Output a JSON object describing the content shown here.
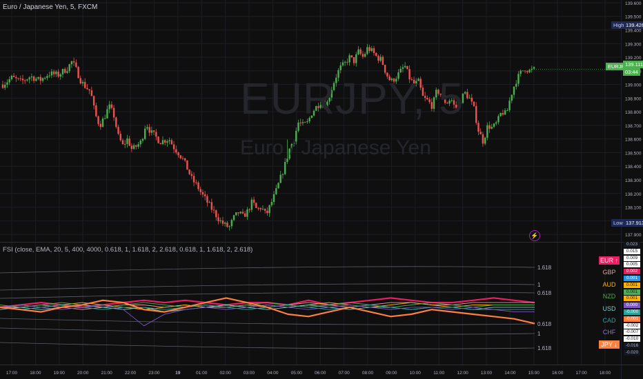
{
  "header": {
    "symbol_title": "Euro / Japanese Yen, 5, FXCM",
    "watermark_symbol": "EURJPY, 5",
    "watermark_name": "Euro / Japanese Yen",
    "indicator_title": "FSI (close, EMA, 20, 5, 400, 4000, 0.618, 1, 1.618, 2, 2.618, 0.618, 1, 1.618, 2, 2.618)"
  },
  "price_axis": {
    "ticks": [
      "139.600",
      "139.500",
      "139.400",
      "139.300",
      "139.200",
      "139.100",
      "139.000",
      "138.900",
      "138.800",
      "138.700",
      "138.600",
      "138.500",
      "138.400",
      "138.300",
      "138.200",
      "138.100",
      "138.000",
      "137.900"
    ],
    "high_label": "High",
    "high_value": "139.426",
    "low_label": "Low",
    "low_value": "137.913",
    "last_symbol": "EURJPY",
    "last_value": "139.111",
    "countdown": "03:44"
  },
  "time_axis": [
    "17:00",
    "18:00",
    "19:00",
    "20:00",
    "21:00",
    "22:00",
    "23:00",
    "19",
    "01:00",
    "02:00",
    "03:00",
    "04:00",
    "05:00",
    "06:00",
    "07:00",
    "08:00",
    "09:00",
    "10:00",
    "11:00",
    "12:00",
    "13:00",
    "14:00",
    "15:00",
    "16:00",
    "17:00",
    "18:00"
  ],
  "fsi_levels": [
    "1.618",
    "1",
    "0.618",
    "0.618",
    "1",
    "1.618"
  ],
  "fsi_axis_values": [
    "0.023",
    "0.015",
    "0.009",
    "0.005",
    "0.002",
    "0.001",
    "0.001",
    "0.001",
    "0.001",
    "0.000",
    "-0.000",
    "-0.001",
    "-0.002",
    "-0.007",
    "-0.010",
    "-0.016",
    "-0.020"
  ],
  "legend": [
    {
      "label": "EUR ↑",
      "color": "#e91e63",
      "bg": "#e91e63",
      "fg": "#ffffff"
    },
    {
      "label": "GBP",
      "color": "#ef9a9a",
      "bg": "",
      "fg": "#ef9a9a"
    },
    {
      "label": "AUD",
      "color": "#ffb300",
      "bg": "",
      "fg": "#ffb300"
    },
    {
      "label": "NZD",
      "color": "#4caf50",
      "bg": "",
      "fg": "#4caf50"
    },
    {
      "label": "USD",
      "color": "#80cbc4",
      "bg": "",
      "fg": "#80cbc4"
    },
    {
      "label": "CAD",
      "color": "#26a69a",
      "bg": "",
      "fg": "#26a69a"
    },
    {
      "label": "CHF",
      "color": "#7e57c2",
      "bg": "",
      "fg": "#9575cd"
    },
    {
      "label": "JPY ↓",
      "color": "#ff7f3f",
      "bg": "#ff7f3f",
      "fg": "#ffffff"
    }
  ],
  "colors": {
    "up": "#4caf50",
    "down": "#ef5350",
    "background": "#0f0f10",
    "grid": "#1c1e24",
    "level_line": "#5d6068"
  },
  "chart_data": [
    {
      "type": "candlestick",
      "title": "Euro / Japanese Yen, 5, FXCM",
      "ylim": [
        137.85,
        139.62
      ],
      "x_ticks": [
        "17:00",
        "18:00",
        "19:00",
        "20:00",
        "21:00",
        "22:00",
        "23:00",
        "19",
        "01:00",
        "02:00",
        "03:00",
        "04:00",
        "05:00",
        "06:00",
        "07:00",
        "08:00",
        "09:00",
        "10:00",
        "11:00",
        "12:00",
        "13:00",
        "14:00",
        "15:00",
        "16:00",
        "17:00",
        "18:00"
      ],
      "close_path": [
        [
          0,
          139.0
        ],
        [
          2,
          139.05
        ],
        [
          4,
          139.02
        ],
        [
          6,
          139.06
        ],
        [
          8,
          139.03
        ],
        [
          10,
          139.08
        ],
        [
          12,
          139.07
        ],
        [
          14,
          139.12
        ],
        [
          15,
          139.17
        ],
        [
          16,
          139.1
        ],
        [
          17,
          139.02
        ],
        [
          18,
          138.98
        ],
        [
          19,
          138.95
        ],
        [
          20,
          138.78
        ],
        [
          21,
          138.7
        ],
        [
          22,
          138.76
        ],
        [
          23,
          138.84
        ],
        [
          24,
          138.78
        ],
        [
          25,
          138.62
        ],
        [
          26,
          138.55
        ],
        [
          27,
          138.6
        ],
        [
          28,
          138.52
        ],
        [
          30,
          138.58
        ],
        [
          31,
          138.72
        ],
        [
          32,
          138.65
        ],
        [
          33,
          138.62
        ],
        [
          34,
          138.58
        ],
        [
          36,
          138.6
        ],
        [
          37,
          138.54
        ],
        [
          38,
          138.5
        ],
        [
          39,
          138.45
        ],
        [
          40,
          138.38
        ],
        [
          41,
          138.3
        ],
        [
          42,
          138.26
        ],
        [
          43,
          138.2
        ],
        [
          44,
          138.15
        ],
        [
          45,
          138.1
        ],
        [
          46,
          138.05
        ],
        [
          47,
          138.0
        ],
        [
          48,
          137.97
        ],
        [
          49,
          137.95
        ],
        [
          50,
          138.02
        ],
        [
          51,
          138.06
        ],
        [
          52,
          138.03
        ],
        [
          53,
          138.07
        ],
        [
          54,
          138.14
        ],
        [
          55,
          138.08
        ],
        [
          56,
          138.1
        ],
        [
          57,
          138.04
        ],
        [
          58,
          138.12
        ],
        [
          59,
          138.2
        ],
        [
          60,
          138.3
        ],
        [
          61,
          138.4
        ],
        [
          62,
          138.52
        ],
        [
          63,
          138.6
        ],
        [
          64,
          138.72
        ],
        [
          65,
          138.7
        ],
        [
          66,
          138.72
        ],
        [
          67,
          138.8
        ],
        [
          68,
          138.84
        ],
        [
          69,
          138.88
        ],
        [
          70,
          138.84
        ],
        [
          71,
          138.95
        ],
        [
          72,
          139.05
        ],
        [
          73,
          139.12
        ],
        [
          74,
          139.15
        ],
        [
          75,
          139.2
        ],
        [
          76,
          139.17
        ],
        [
          77,
          139.24
        ],
        [
          78,
          139.2
        ],
        [
          79,
          139.27
        ],
        [
          80,
          139.24
        ],
        [
          81,
          139.2
        ],
        [
          82,
          139.18
        ],
        [
          83,
          139.08
        ],
        [
          84,
          139.02
        ],
        [
          85,
          139.05
        ],
        [
          86,
          139.09
        ],
        [
          87,
          139.14
        ],
        [
          88,
          139.05
        ],
        [
          89,
          139.0
        ],
        [
          90,
          139.02
        ],
        [
          91,
          138.9
        ],
        [
          92,
          138.88
        ],
        [
          93,
          138.84
        ],
        [
          94,
          138.96
        ],
        [
          95,
          138.92
        ],
        [
          96,
          138.86
        ],
        [
          97,
          138.9
        ],
        [
          98,
          138.82
        ],
        [
          99,
          138.88
        ],
        [
          100,
          138.94
        ],
        [
          101,
          138.9
        ],
        [
          102,
          138.82
        ],
        [
          103,
          138.66
        ],
        [
          104,
          138.58
        ],
        [
          105,
          138.7
        ],
        [
          106,
          138.68
        ],
        [
          107,
          138.72
        ],
        [
          108,
          138.8
        ],
        [
          109,
          138.78
        ],
        [
          110,
          138.92
        ],
        [
          111,
          139.02
        ],
        [
          112,
          139.08
        ],
        [
          113,
          139.12
        ],
        [
          114,
          139.1
        ],
        [
          115,
          139.11
        ]
      ]
    },
    {
      "type": "line",
      "title": "FSI (close, EMA, 20, 5, 400, 4000, 0.618, 1, 1.618, 2, 2.618, 0.618, 1, 1.618, 2, 2.618)",
      "ylim": [
        -0.022,
        0.024
      ],
      "levels": [
        "1.618",
        "1",
        "0.618",
        "0.618",
        "1",
        "1.618"
      ],
      "series": [
        {
          "name": "EUR ↑",
          "color": "#e91e63",
          "values": [
            0.0,
            0.001,
            0.002,
            0.001,
            0.0,
            0.001,
            0.002,
            0.003,
            0.002,
            0.003,
            0.002,
            0.001,
            0.002,
            0.002,
            0.001,
            0.003,
            0.001,
            0.002,
            0.003,
            0.004,
            0.003,
            0.002,
            0.002,
            0.003,
            0.004,
            0.003,
            0.002
          ]
        },
        {
          "name": "GBP",
          "color": "#ef9a9a",
          "values": [
            0.0,
            0.0,
            0.001,
            0.0,
            -0.001,
            0.0,
            0.001,
            0.001,
            0.0,
            0.001,
            0.0,
            0.0,
            0.001,
            0.0,
            0.001,
            0.002,
            0.001,
            0.0,
            0.001,
            0.002,
            0.002,
            0.001,
            0.001,
            0.002,
            0.002,
            0.002,
            0.002
          ]
        },
        {
          "name": "AUD",
          "color": "#ffb300",
          "values": [
            0.0,
            0.001,
            0.0,
            0.001,
            0.002,
            0.001,
            0.0,
            -0.001,
            0.0,
            0.001,
            0.0,
            0.001,
            0.0,
            0.001,
            0.0,
            0.001,
            0.002,
            0.001,
            0.0,
            0.001,
            0.002,
            0.001,
            0.0,
            0.001,
            0.001,
            0.001,
            0.001
          ]
        },
        {
          "name": "NZD",
          "color": "#4caf50",
          "values": [
            0.001,
            0.0,
            0.001,
            0.002,
            0.001,
            0.0,
            0.001,
            0.002,
            0.001,
            0.0,
            0.001,
            0.0,
            0.001,
            0.002,
            0.001,
            0.0,
            0.001,
            0.002,
            0.001,
            0.0,
            0.001,
            0.002,
            0.001,
            0.0,
            0.001,
            0.001,
            0.001
          ]
        },
        {
          "name": "USD",
          "color": "#80cbc4",
          "values": [
            -0.001,
            0.0,
            -0.001,
            0.0,
            0.001,
            0.0,
            -0.001,
            0.0,
            -0.002,
            -0.001,
            0.0,
            0.001,
            0.0,
            -0.001,
            0.0,
            0.001,
            0.0,
            -0.001,
            0.0,
            0.0,
            -0.001,
            0.0,
            0.0,
            -0.001,
            0.0,
            0.0,
            0.0
          ]
        },
        {
          "name": "CAD",
          "color": "#26a69a",
          "values": [
            0.0,
            -0.001,
            0.0,
            0.001,
            0.0,
            -0.001,
            0.0,
            0.0,
            -0.001,
            0.0,
            0.001,
            0.0,
            -0.001,
            0.0,
            0.001,
            0.0,
            -0.001,
            0.0,
            0.001,
            0.0,
            -0.001,
            0.0,
            0.0,
            -0.001,
            -0.001,
            -0.001,
            -0.001
          ]
        },
        {
          "name": "CHF",
          "color": "#7e57c2",
          "values": [
            0.0,
            0.001,
            0.0,
            -0.001,
            0.0,
            0.001,
            -0.001,
            -0.008,
            -0.003,
            -0.001,
            0.0,
            -0.001,
            0.0,
            0.001,
            0.0,
            -0.001,
            0.0,
            0.001,
            0.0,
            -0.001,
            0.0,
            0.0,
            -0.001,
            0.0,
            -0.001,
            -0.002,
            -0.002
          ]
        },
        {
          "name": "JPY ↓",
          "color": "#ff7f3f",
          "values": [
            0.0,
            -0.001,
            -0.002,
            0.0,
            0.001,
            0.003,
            0.002,
            -0.001,
            -0.002,
            0.0,
            0.002,
            0.004,
            0.002,
            0.0,
            -0.003,
            -0.004,
            -0.002,
            0.0,
            -0.002,
            -0.004,
            -0.003,
            -0.001,
            -0.002,
            -0.003,
            -0.004,
            -0.005,
            -0.007
          ]
        }
      ]
    }
  ]
}
